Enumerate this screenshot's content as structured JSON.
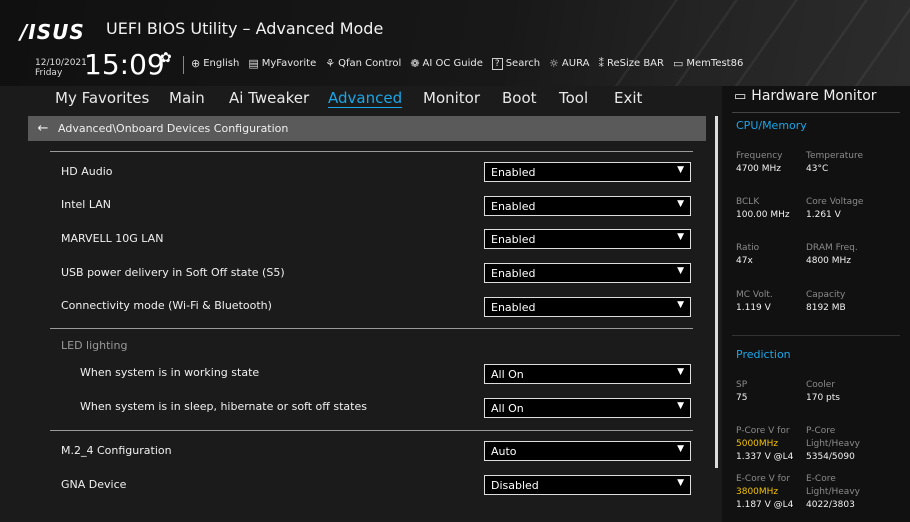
{
  "header": {
    "logo": "/ISUS",
    "title": "UEFI BIOS Utility – Advanced Mode",
    "date": "12/10/2021",
    "day": "Friday",
    "time": "15:09",
    "tools": [
      {
        "icon": "globe-icon",
        "glyph": "⊕",
        "label": "English"
      },
      {
        "icon": "favorite-icon",
        "glyph": "▤",
        "label": "MyFavorite"
      },
      {
        "icon": "fan-icon",
        "glyph": "⚘",
        "label": "Qfan Control"
      },
      {
        "icon": "ai-oc-icon",
        "glyph": "❁",
        "label": "AI OC Guide"
      },
      {
        "icon": "search-icon",
        "glyph": "?",
        "label": "Search"
      },
      {
        "icon": "aura-icon",
        "glyph": "☼",
        "label": "AURA"
      },
      {
        "icon": "resize-bar-icon",
        "glyph": "⁑",
        "label": "ReSize BAR"
      },
      {
        "icon": "memtest-icon",
        "glyph": "▭",
        "label": "MemTest86"
      }
    ]
  },
  "nav": [
    "My Favorites",
    "Main",
    "Ai Tweaker",
    "Advanced",
    "Monitor",
    "Boot",
    "Tool",
    "Exit"
  ],
  "breadcrumb": "Advanced\\Onboard Devices Configuration",
  "settings": [
    {
      "label": "HD Audio",
      "value": "Enabled"
    },
    {
      "label": "Intel LAN",
      "value": "Enabled"
    },
    {
      "label": "MARVELL 10G LAN",
      "value": "Enabled"
    },
    {
      "label": "USB power delivery in Soft Off state (S5)",
      "value": "Enabled"
    },
    {
      "label": "Connectivity mode (Wi-Fi & Bluetooth)",
      "value": "Enabled"
    },
    {
      "label": "LED lighting"
    },
    {
      "label": "When system is in working state",
      "value": "All On"
    },
    {
      "label": "When system is in sleep, hibernate or soft off states",
      "value": "All On"
    },
    {
      "label": "M.2_4 Configuration",
      "value": "Auto"
    },
    {
      "label": "GNA Device",
      "value": "Disabled"
    }
  ],
  "hardware_monitor": {
    "title": "Hardware Monitor",
    "cpu_memory": {
      "title": "CPU/Memory",
      "items": [
        {
          "key": "Frequency",
          "value": "4700 MHz"
        },
        {
          "key": "Temperature",
          "value": "43°C"
        },
        {
          "key": "BCLK",
          "value": "100.00 MHz"
        },
        {
          "key": "Core Voltage",
          "value": "1.261 V"
        },
        {
          "key": "Ratio",
          "value": "47x"
        },
        {
          "key": "DRAM Freq.",
          "value": "4800 MHz"
        },
        {
          "key": "MC Volt.",
          "value": "1.119 V"
        },
        {
          "key": "Capacity",
          "value": "8192 MB"
        }
      ]
    },
    "prediction": {
      "title": "Prediction",
      "sp_key": "SP",
      "sp_value": "75",
      "cooler_key": "Cooler",
      "cooler_value": "170 pts",
      "pcore_v_key": "P-Core V for",
      "pcore_v_freq": "5000MHz",
      "pcore_v_value": "1.337 V @L4",
      "pcore_key": "P-Core",
      "pcore_sub": "Light/Heavy",
      "pcore_value": "5354/5090",
      "ecore_v_key": "E-Core V for",
      "ecore_v_freq": "3800MHz",
      "ecore_v_value": "1.187 V @L4",
      "ecore_key": "E-Core",
      "ecore_sub": "Light/Heavy",
      "ecore_value": "4022/3803"
    }
  },
  "colors": {
    "accent": "#1aa6e8",
    "highlight": "#f2c200",
    "background": "#1b1b1b"
  }
}
